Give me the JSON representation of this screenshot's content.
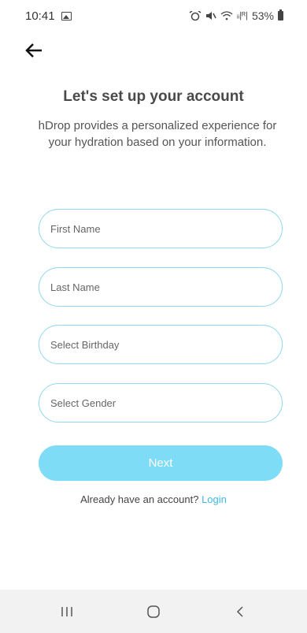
{
  "status_bar": {
    "time": "10:41",
    "signal_text": "ᵢᵢ|ᴿ|",
    "battery_percent": "53%"
  },
  "header": {
    "title": "Let's set up your account",
    "subtitle": "hDrop provides a personalized experience for your hydration based on your information."
  },
  "form": {
    "first_name": {
      "value": "",
      "placeholder": "First Name"
    },
    "last_name": {
      "value": "",
      "placeholder": "Last Name"
    },
    "birthday": {
      "value": "",
      "placeholder": "Select Birthday"
    },
    "gender": {
      "value": "",
      "placeholder": "Select Gender"
    }
  },
  "actions": {
    "next_label": "Next",
    "login_prompt": "Already have an account?",
    "login_label": "Login"
  },
  "colors": {
    "accent": "#7fdcf7",
    "field_border": "#8fd8ee",
    "link": "#3fb8e6"
  },
  "icons": {
    "back": "arrow-left-icon",
    "nav_recents": "recent-apps-icon",
    "nav_home": "home-icon",
    "nav_back": "back-chevron-icon"
  }
}
